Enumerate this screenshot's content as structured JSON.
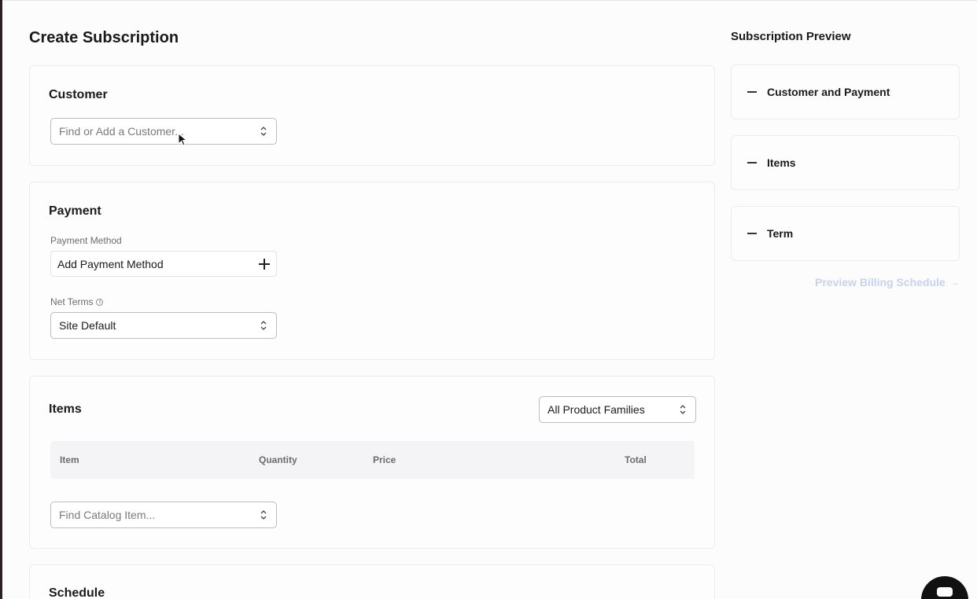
{
  "page": {
    "title": "Create Subscription"
  },
  "customer": {
    "title": "Customer",
    "search_placeholder": "Find or Add a Customer..."
  },
  "payment": {
    "title": "Payment",
    "method_label": "Payment Method",
    "add_method_label": "Add Payment Method",
    "net_terms_label": "Net Terms",
    "net_terms_value": "Site Default"
  },
  "items": {
    "title": "Items",
    "product_family_value": "All Product Families",
    "columns": [
      "Item",
      "Quantity",
      "Price",
      "Total"
    ],
    "catalog_placeholder": "Find Catalog Item..."
  },
  "schedule": {
    "title": "Schedule"
  },
  "preview": {
    "title": "Subscription Preview",
    "sections": [
      "Customer and Payment",
      "Items",
      "Term"
    ],
    "billing_link": "Preview Billing Schedule"
  },
  "colors": {
    "accent_disabled": "#c5d4ec",
    "border": "#bdbdbd",
    "table_header_bg": "#f4f4f6"
  },
  "icons": {
    "select_chevrons": "chevron-up-down-icon",
    "add": "plus-icon",
    "info": "info-icon",
    "collapse": "dash-icon",
    "link_arrow": "arrow-right-icon",
    "chat": "chat-icon"
  }
}
